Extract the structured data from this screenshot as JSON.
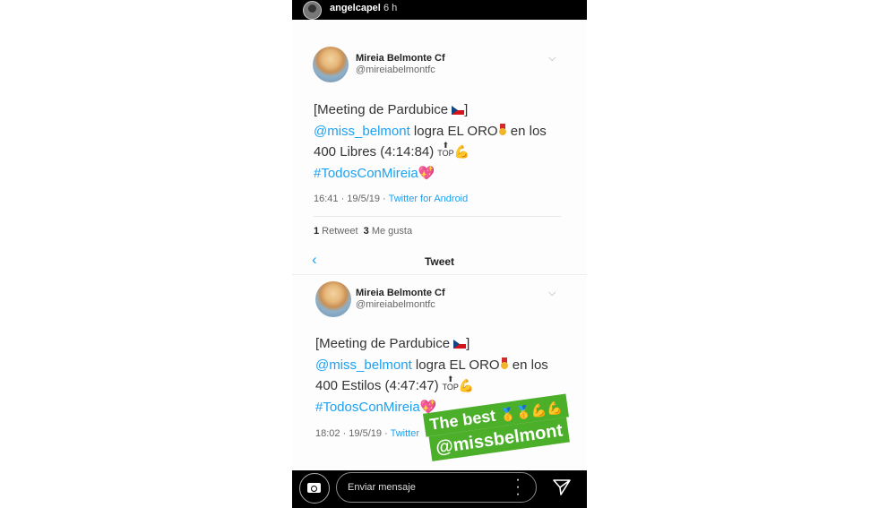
{
  "story": {
    "username": "angelcapel",
    "time": "6 h"
  },
  "tweet1": {
    "name": "Mireia Belmonte Cf",
    "handle": "@mireiabelmontfc",
    "line1": "[Meeting de Pardubice",
    "mention": "@miss_belmont",
    "line2_rest": " logra EL ORO",
    "line2_tail": " en los",
    "line3": "400 Libres (4:14:84)",
    "hashtag": "#TodosConMireia",
    "timestamp": "16:41 · 19/5/19 · ",
    "source": "Twitter for Android",
    "retweets": "1",
    "retweets_label": " Retweet  ",
    "likes": "3",
    "likes_label": " Me gusta"
  },
  "header": {
    "title": "Tweet"
  },
  "tweet2": {
    "name": "Mireia Belmonte Cf",
    "handle": "@mireiabelmontfc",
    "line1": "[Meeting de Pardubice",
    "mention": "@miss_belmont",
    "line2_rest": " logra EL ORO",
    "line2_tail": " en los",
    "line3": "400 Estilos (4:47:47)",
    "hashtag": "#TodosConMireia",
    "timestamp": "18:02 · 19/5/19 · ",
    "source": "Twitter"
  },
  "sticker": {
    "line1": "The best",
    "line2": "@missbelmont"
  },
  "composer": {
    "placeholder": "Enviar mensaje"
  },
  "icons": {
    "camera": "camera-icon",
    "send": "send-icon",
    "more": "more-icon",
    "back": "back-chevron-icon"
  }
}
